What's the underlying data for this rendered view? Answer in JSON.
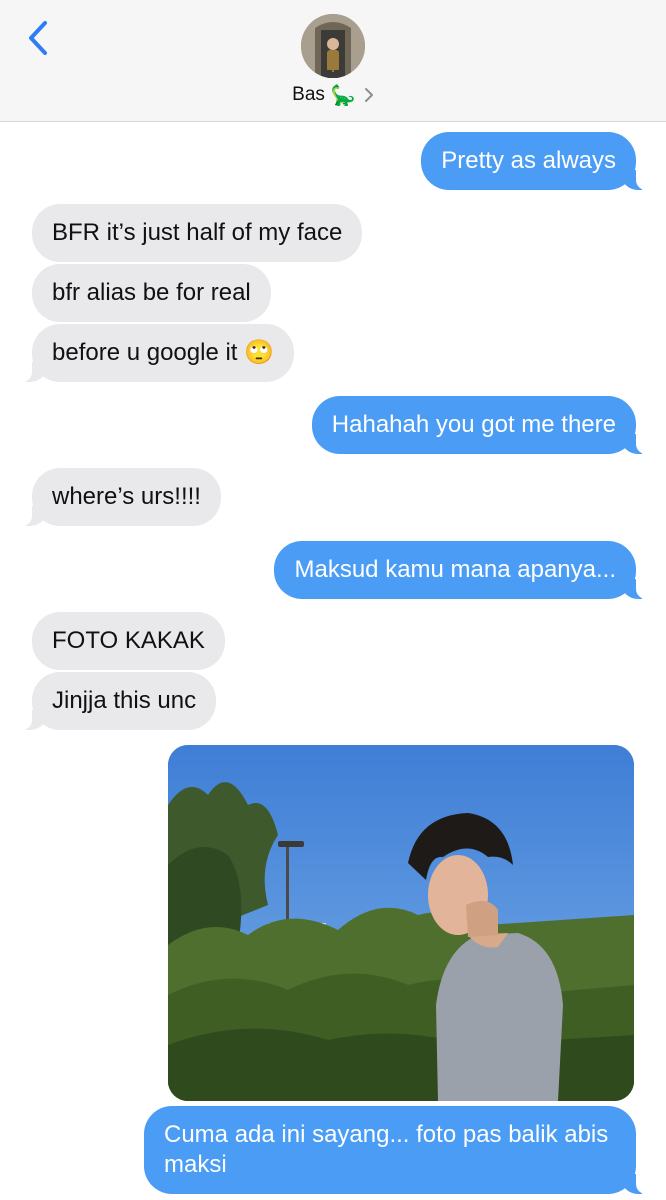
{
  "header": {
    "contact_name": "Bas",
    "contact_emoji": "🦕",
    "back_icon": "chevron-left-icon",
    "details_icon": "chevron-right-icon",
    "accent_color": "#2f7cf6"
  },
  "messages": [
    {
      "id": "m1",
      "side": "out",
      "text": "Pretty as always"
    },
    {
      "id": "m2",
      "side": "in",
      "text": "BFR it’s just half of my face"
    },
    {
      "id": "m3",
      "side": "in",
      "text": "bfr alias be for real"
    },
    {
      "id": "m4",
      "side": "in",
      "text": "before u google it 🙄"
    },
    {
      "id": "m5",
      "side": "out",
      "text": "Hahahah you got me there"
    },
    {
      "id": "m6",
      "side": "in",
      "text": "where’s urs!!!!"
    },
    {
      "id": "m7",
      "side": "out",
      "text": "Maksud kamu mana apanya..."
    },
    {
      "id": "m8",
      "side": "in",
      "text": "FOTO KAKAK"
    },
    {
      "id": "m9",
      "side": "in",
      "text": "Jinjja this unc"
    },
    {
      "id": "m10",
      "side": "out",
      "type": "photo",
      "subject": "person-outdoors-photo"
    },
    {
      "id": "m11",
      "side": "out",
      "text": "Cuma ada ini sayang... foto pas balik abis maksi"
    }
  ],
  "colors": {
    "outgoing_bubble": "#4a9cf5",
    "incoming_bubble": "#e9e9eb",
    "header_bg": "#f6f6f6"
  }
}
